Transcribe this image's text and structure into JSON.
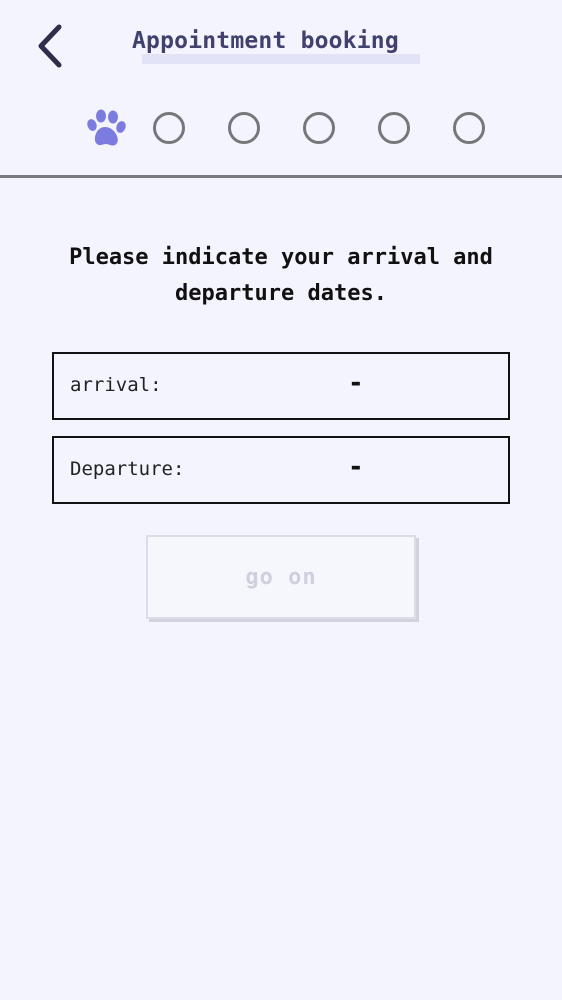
{
  "header": {
    "title": "Appointment booking",
    "back_icon": "chevron-left-icon"
  },
  "steps": {
    "total": 6,
    "current": 1,
    "active_icon": "paw-icon",
    "accent_color": "#7b7be0"
  },
  "main": {
    "prompt": "Please indicate your arrival and departure dates.",
    "arrival": {
      "label": "arrival:",
      "value": "-"
    },
    "departure": {
      "label": "Departure:",
      "value": "-"
    },
    "go_on_label": "go on"
  },
  "colors": {
    "background": "#f4f4fe",
    "title": "#41416e",
    "disabled_text": "#cfcfdd"
  }
}
